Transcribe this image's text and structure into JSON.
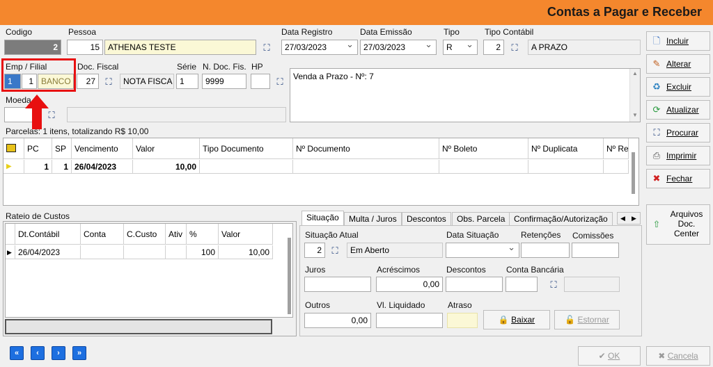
{
  "window": {
    "title": "Contas a Pagar e Receber"
  },
  "header": {
    "codigo_label": "Codigo",
    "codigo_value": "2",
    "pessoa_label": "Pessoa",
    "pessoa_code": "15",
    "pessoa_name": "ATHENAS TESTE",
    "data_registro_label": "Data Registro",
    "data_registro_value": "27/03/2023",
    "data_emissao_label": "Data Emissão",
    "data_emissao_value": "27/03/2023",
    "tipo_label": "Tipo",
    "tipo_value": "R",
    "tipo_contabil_label": "Tipo Contábil",
    "tipo_contabil_code": "2",
    "tipo_contabil_name": "A PRAZO",
    "emp_filial_label": "Emp / Filial",
    "emp_value": "1",
    "filial_value": "1",
    "banco_value": "BANCO D",
    "doc_fiscal_label": "Doc. Fiscal",
    "doc_fiscal_code": "27",
    "doc_fiscal_name": "NOTA FISCA",
    "serie_label": "Série",
    "serie_value": "1",
    "ndoc_label": "N. Doc. Fis.",
    "ndoc_value": "9999",
    "hp_label": "HP",
    "hp_value": "",
    "obs_text": "Venda a Prazo - Nº: 7",
    "moeda_label": "Moeda"
  },
  "parcelas": {
    "summary": "Parcelas: 1 itens, totalizando R$ 10,00",
    "columns": [
      "PC",
      "SP",
      "Vencimento",
      "Valor",
      "Tipo Documento",
      "Nº Documento",
      "Nº Boleto",
      "Nº Duplicata",
      "Nº Re"
    ],
    "rows": [
      {
        "pc": "1",
        "sp": "1",
        "vencimento": "26/04/2023",
        "valor": "10,00"
      }
    ]
  },
  "rateio": {
    "title": "Rateio de Custos",
    "columns": [
      "Dt.Contábil",
      "Conta",
      "C.Custo",
      "Ativ",
      "%",
      "Valor"
    ],
    "rows": [
      {
        "dt": "26/04/2023",
        "conta": "",
        "ccusto": "",
        "ativ": "",
        "pct": "100",
        "valor": "10,00"
      }
    ]
  },
  "tabs": [
    "Situação",
    "Multa / Juros",
    "Descontos",
    "Obs. Parcela",
    "Confirmação/Autorização"
  ],
  "situacao": {
    "situacao_atual_label": "Situação Atual",
    "situacao_code": "2",
    "situacao_name": "Em Aberto",
    "data_situacao_label": "Data Situação",
    "retencoes_label": "Retenções",
    "comissoes_label": "Comissões",
    "juros_label": "Juros",
    "acrescimos_label": "Acréscimos",
    "acrescimos_value": "0,00",
    "descontos_label": "Descontos",
    "conta_bancaria_label": "Conta Bancária",
    "outros_label": "Outros",
    "outros_value": "0,00",
    "vl_liquidado_label": "Vl. Liquidado",
    "atraso_label": "Atraso",
    "baixar_label": "Baixar",
    "estornar_label": "Estornar"
  },
  "sidebar": {
    "incluir": "Incluir",
    "alterar": "Alterar",
    "excluir": "Excluir",
    "atualizar": "Atualizar",
    "procurar": "Procurar",
    "imprimir": "Imprimir",
    "fechar": "Fechar",
    "arquivos": "Arquivos Doc. Center"
  },
  "footer": {
    "ok": "OK",
    "cancela": "Cancela"
  },
  "colors": {
    "titlebar": "#f4872d",
    "highlight": "#e81010",
    "nav": "#1d6fe0"
  }
}
